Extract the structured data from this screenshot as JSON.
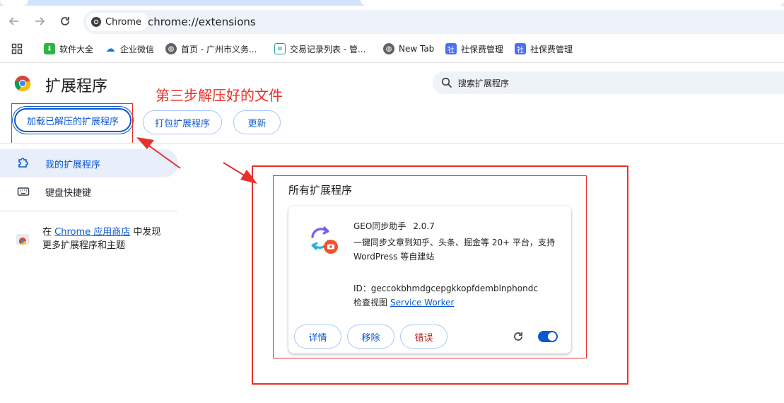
{
  "browser": {
    "chip_label": "Chrome",
    "url": "chrome://extensions"
  },
  "bookmarks": [
    {
      "label": "软件大全",
      "icon": "download-icon",
      "color": "#2fb344"
    },
    {
      "label": "企业微信",
      "icon": "wecom-icon",
      "color": "#1a73e8"
    },
    {
      "label": "首页 - 广州市义务...",
      "icon": "globe-icon",
      "color": "#5f6368"
    },
    {
      "label": "交易记录列表 - 管...",
      "icon": "ledger-icon",
      "color": "#1aa39b"
    },
    {
      "label": "New Tab",
      "icon": "globe-icon",
      "color": "#5f6368"
    },
    {
      "label": "社保费管理",
      "icon": "tax-icon",
      "color": "#4c6ef5"
    },
    {
      "label": "社保费管理",
      "icon": "tax-icon",
      "color": "#4c6ef5"
    }
  ],
  "header": {
    "title": "扩展程序",
    "search_placeholder": "搜索扩展程序"
  },
  "annotation": {
    "note": "第三步解压好的文件",
    "color": "#e8312b"
  },
  "actions": {
    "load_unpacked": "加载已解压的扩展程序",
    "pack": "打包扩展程序",
    "update": "更新"
  },
  "sidebar": {
    "items": [
      {
        "label": "我的扩展程序",
        "icon": "extension-icon",
        "active": true
      },
      {
        "label": "键盘快捷键",
        "icon": "keyboard-icon",
        "active": false
      }
    ],
    "promo_prefix": "在 ",
    "promo_link": "Chrome 应用商店",
    "promo_suffix": " 中发现",
    "promo_line2": "更多扩展程序和主题"
  },
  "extensions": {
    "section_title": "所有扩展程序",
    "items": [
      {
        "name": "GEO同步助手",
        "version": "2.0.7",
        "description": "一键同步文章到知乎、头条、掘金等 20+ 平台，支持 WordPress 等自建站",
        "id_label": "ID：",
        "id": "geccokbhmdgcepgkkopfdemblnphondc",
        "views_label": "检查视图",
        "views_link": "Service Worker",
        "details_label": "详情",
        "remove_label": "移除",
        "errors_label": "错误",
        "enabled": true
      }
    ]
  },
  "colors": {
    "accent": "#0b57d0",
    "annotation": "#e8312b"
  }
}
